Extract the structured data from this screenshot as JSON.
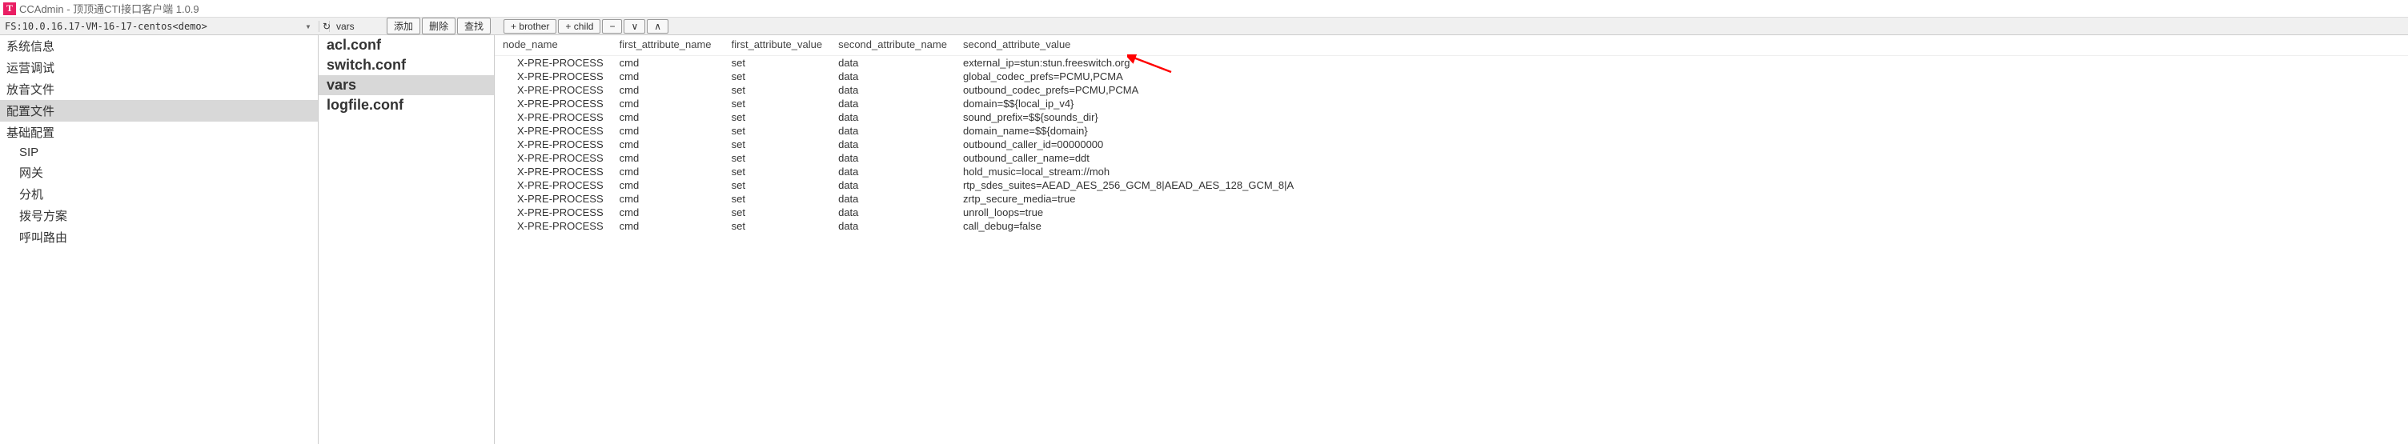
{
  "window": {
    "app_icon_letter": "T",
    "title": "CCAdmin - 顶顶通CTI接口客户端 1.0.9"
  },
  "fsbar": {
    "fs_text": "FS:10.0.16.17-VM-16-17-centos<demo>",
    "refresh_glyph": "↻",
    "current_file": "vars",
    "btn_add": "添加",
    "btn_delete": "删除",
    "btn_find": "查找",
    "btn_brother": "+ brother",
    "btn_child": "+ child",
    "btn_minus": "−",
    "btn_down": "∨",
    "btn_up": "∧"
  },
  "sidebar": {
    "items": [
      {
        "label": "系统信息",
        "child": false,
        "selected": false
      },
      {
        "label": "运营调试",
        "child": false,
        "selected": false
      },
      {
        "label": "放音文件",
        "child": false,
        "selected": false
      },
      {
        "label": "配置文件",
        "child": false,
        "selected": true
      },
      {
        "label": "基础配置",
        "child": false,
        "selected": false
      },
      {
        "label": "SIP",
        "child": true,
        "selected": false
      },
      {
        "label": "网关",
        "child": true,
        "selected": false
      },
      {
        "label": "分机",
        "child": true,
        "selected": false
      },
      {
        "label": "拨号方案",
        "child": true,
        "selected": false
      },
      {
        "label": "呼叫路由",
        "child": true,
        "selected": false
      }
    ]
  },
  "filelist": {
    "items": [
      {
        "label": "acl.conf",
        "selected": false
      },
      {
        "label": "switch.conf",
        "selected": false
      },
      {
        "label": "vars",
        "selected": true
      },
      {
        "label": "logfile.conf",
        "selected": false
      }
    ]
  },
  "table": {
    "headers": {
      "c1": "node_name",
      "c2": "first_attribute_name",
      "c3": "first_attribute_value",
      "c4": "second_attribute_name",
      "c5": "second_attribute_value"
    },
    "rows": [
      {
        "c1": "X-PRE-PROCESS",
        "c2": "cmd",
        "c3": "set",
        "c4": "data",
        "c5": "external_ip=stun:stun.freeswitch.org"
      },
      {
        "c1": "X-PRE-PROCESS",
        "c2": "cmd",
        "c3": "set",
        "c4": "data",
        "c5": "global_codec_prefs=PCMU,PCMA"
      },
      {
        "c1": "X-PRE-PROCESS",
        "c2": "cmd",
        "c3": "set",
        "c4": "data",
        "c5": "outbound_codec_prefs=PCMU,PCMA"
      },
      {
        "c1": "X-PRE-PROCESS",
        "c2": "cmd",
        "c3": "set",
        "c4": "data",
        "c5": "domain=$${local_ip_v4}"
      },
      {
        "c1": "X-PRE-PROCESS",
        "c2": "cmd",
        "c3": "set",
        "c4": "data",
        "c5": "sound_prefix=$${sounds_dir}"
      },
      {
        "c1": "X-PRE-PROCESS",
        "c2": "cmd",
        "c3": "set",
        "c4": "data",
        "c5": "domain_name=$${domain}"
      },
      {
        "c1": "X-PRE-PROCESS",
        "c2": "cmd",
        "c3": "set",
        "c4": "data",
        "c5": "outbound_caller_id=00000000"
      },
      {
        "c1": "X-PRE-PROCESS",
        "c2": "cmd",
        "c3": "set",
        "c4": "data",
        "c5": "outbound_caller_name=ddt"
      },
      {
        "c1": "X-PRE-PROCESS",
        "c2": "cmd",
        "c3": "set",
        "c4": "data",
        "c5": "hold_music=local_stream://moh"
      },
      {
        "c1": "X-PRE-PROCESS",
        "c2": "cmd",
        "c3": "set",
        "c4": "data",
        "c5": "rtp_sdes_suites=AEAD_AES_256_GCM_8|AEAD_AES_128_GCM_8|A"
      },
      {
        "c1": "X-PRE-PROCESS",
        "c2": "cmd",
        "c3": "set",
        "c4": "data",
        "c5": "zrtp_secure_media=true"
      },
      {
        "c1": "X-PRE-PROCESS",
        "c2": "cmd",
        "c3": "set",
        "c4": "data",
        "c5": "unroll_loops=true"
      },
      {
        "c1": "X-PRE-PROCESS",
        "c2": "cmd",
        "c3": "set",
        "c4": "data",
        "c5": "call_debug=false"
      }
    ]
  }
}
